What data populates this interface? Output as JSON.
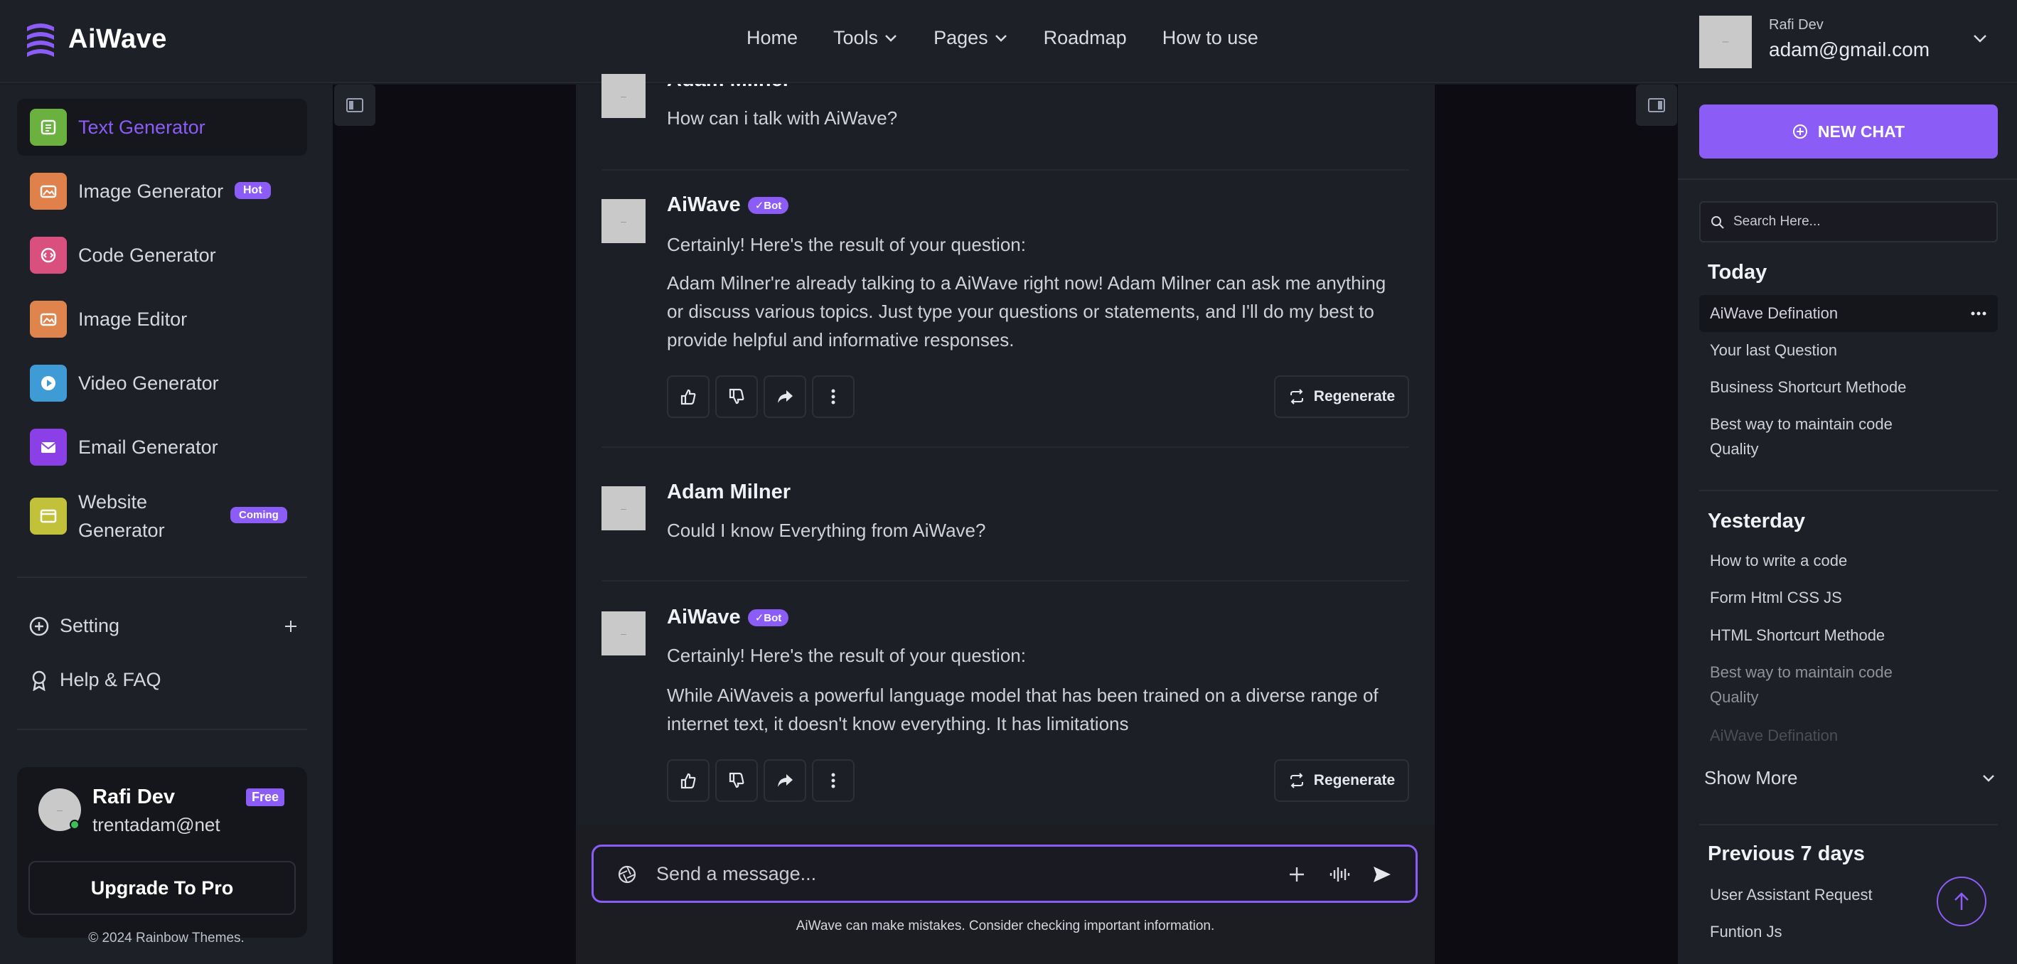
{
  "header": {
    "logo_text": "AiWave",
    "nav": [
      "Home",
      "Tools",
      "Pages",
      "Roadmap",
      "How to use"
    ],
    "user_name": "Rafi Dev",
    "user_email": "adam@gmail.com"
  },
  "sidebar": {
    "items": [
      {
        "label": "Text Generator",
        "icon": "text-icon",
        "color": "#6bb13f",
        "active": true
      },
      {
        "label": "Image Generator",
        "icon": "image-icon",
        "color": "#e0804a",
        "badge": "Hot"
      },
      {
        "label": "Code Generator",
        "icon": "code-icon",
        "color": "#d9507e"
      },
      {
        "label": "Image Editor",
        "icon": "image-icon",
        "color": "#e0844e"
      },
      {
        "label": "Video Generator",
        "icon": "play-icon",
        "color": "#3f9bd6"
      },
      {
        "label": "Email Generator",
        "icon": "mail-icon",
        "color": "#8b3fe6"
      },
      {
        "label": "Website Generator",
        "icon": "window-icon",
        "color": "#c2c23a",
        "badge": "Coming"
      }
    ],
    "setting_label": "Setting",
    "help_label": "Help & FAQ",
    "user_card": {
      "name": "Rafi Dev",
      "email": "trentadam@net",
      "plan": "Free",
      "upgrade_label": "Upgrade To Pro"
    },
    "copyright": "© 2024  Rainbow Themes."
  },
  "chat": {
    "messages": [
      {
        "author": "Adam Milner",
        "text": "How can i talk with AiWave?"
      },
      {
        "author": "AiWave",
        "badge": "Bot",
        "intro": "Certainly! Here's the result of your question:",
        "text": "Adam Milner're already talking to a AiWave right now! Adam Milner can ask me anything or discuss various topics. Just type your questions or statements, and I'll do my best to provide helpful and informative responses.",
        "regen_label": "Regenerate"
      },
      {
        "author": "Adam Milner",
        "text": "Could I know Everything from AiWave?"
      },
      {
        "author": "AiWave",
        "badge": "Bot",
        "intro": "Certainly! Here's the result of your question:",
        "text": "While AiWaveis a powerful language model that has been trained on a diverse range of internet text, it doesn't know everything. It has limitations",
        "regen_label": "Regenerate"
      }
    ],
    "composer_placeholder": "Send a message...",
    "disclaimer": "AiWave can make mistakes. Consider checking important information."
  },
  "history": {
    "new_chat_label": "NEW CHAT",
    "search_placeholder": "Search Here...",
    "today_title": "Today",
    "today": [
      "AiWave Defination",
      "Your last Question",
      "Business Shortcurt Methode",
      "Best way to maintain code Quality"
    ],
    "yesterday_title": "Yesterday",
    "yesterday": [
      "How to write a code",
      "Form Html CSS JS",
      "HTML Shortcurt Methode",
      "Best way to maintain code Quality",
      "AiWave Defination"
    ],
    "show_more": "Show More",
    "prev7_title": "Previous 7 days",
    "prev7": [
      "User Assistant Request",
      "Funtion Js"
    ]
  },
  "colors": {
    "accent": "#8b5cf6",
    "background": "#1a1c22"
  }
}
